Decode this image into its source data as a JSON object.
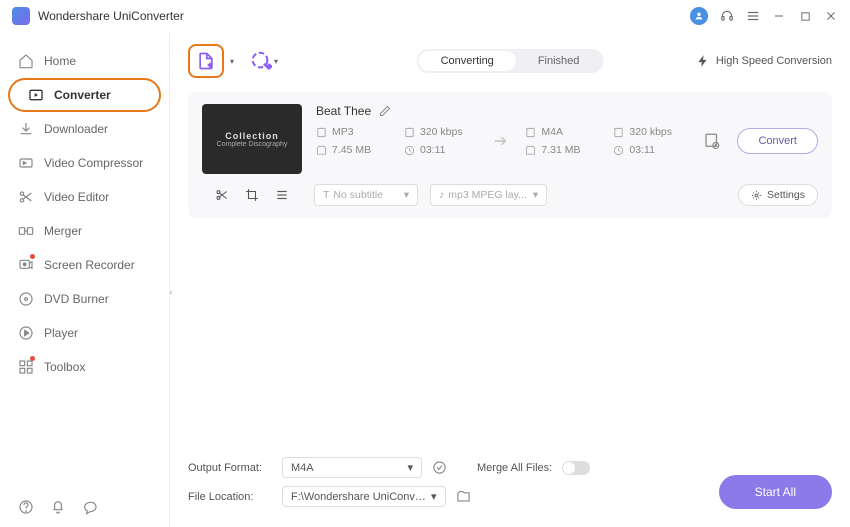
{
  "app": {
    "title": "Wondershare UniConverter"
  },
  "sidebar": {
    "items": [
      {
        "label": "Home"
      },
      {
        "label": "Converter"
      },
      {
        "label": "Downloader"
      },
      {
        "label": "Video Compressor"
      },
      {
        "label": "Video Editor"
      },
      {
        "label": "Merger"
      },
      {
        "label": "Screen Recorder"
      },
      {
        "label": "DVD Burner"
      },
      {
        "label": "Player"
      },
      {
        "label": "Toolbox"
      }
    ]
  },
  "toolbar": {
    "tabs": {
      "converting": "Converting",
      "finished": "Finished"
    },
    "highspeed": "High Speed Conversion"
  },
  "file": {
    "title": "Beat Thee",
    "thumb": {
      "line1": "Collection",
      "line2": "Complete Discography"
    },
    "src": {
      "format": "MP3",
      "bitrate": "320 kbps",
      "size": "7.45 MB",
      "duration": "03:11"
    },
    "dst": {
      "format": "M4A",
      "bitrate": "320 kbps",
      "size": "7.31 MB",
      "duration": "03:11"
    },
    "convert_label": "Convert",
    "subtitle_placeholder": "No subtitle",
    "audio_placeholder": "mp3 MPEG lay...",
    "settings_label": "Settings"
  },
  "footer": {
    "output_format_label": "Output Format:",
    "output_format_value": "M4A",
    "file_location_label": "File Location:",
    "file_location_value": "F:\\Wondershare UniConverter",
    "merge_label": "Merge All Files:",
    "start_all": "Start All"
  }
}
